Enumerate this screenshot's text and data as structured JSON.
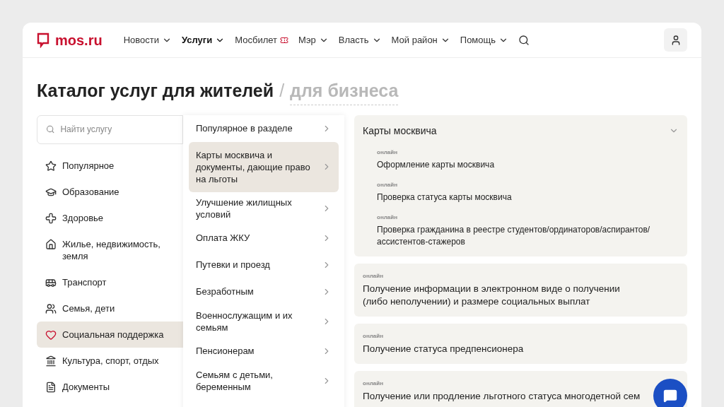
{
  "header": {
    "logo": "mos.ru",
    "nav": [
      {
        "label": "Новости",
        "selected": false,
        "kind": "dropdown"
      },
      {
        "label": "Услуги",
        "selected": true,
        "kind": "dropdown"
      },
      {
        "label": "Мосбилет",
        "selected": false,
        "kind": "ticket"
      },
      {
        "label": "Мэр",
        "selected": false,
        "kind": "dropdown"
      },
      {
        "label": "Власть",
        "selected": false,
        "kind": "dropdown"
      },
      {
        "label": "Мой район",
        "selected": false,
        "kind": "dropdown"
      },
      {
        "label": "Помощь",
        "selected": false,
        "kind": "dropdown"
      }
    ]
  },
  "title": {
    "main": "Каталог услуг для жителей",
    "separator": "/",
    "alt": "для бизнеса"
  },
  "search": {
    "placeholder": "Найти услугу"
  },
  "categories": [
    {
      "label": "Популярное",
      "selected": false
    },
    {
      "label": "Образование",
      "selected": false
    },
    {
      "label": "Здоровье",
      "selected": false
    },
    {
      "label": "Жилье, недвижимость, земля",
      "selected": false
    },
    {
      "label": "Транспорт",
      "selected": false
    },
    {
      "label": "Семья, дети",
      "selected": false
    },
    {
      "label": "Социальная поддержка",
      "selected": true
    },
    {
      "label": "Культура, спорт, отдых",
      "selected": false
    },
    {
      "label": "Документы",
      "selected": false
    }
  ],
  "subcategories": [
    {
      "label": "Популярное в разделе",
      "selected": false
    },
    {
      "label": "Карты москвича и документы, дающие право на льготы",
      "selected": true
    },
    {
      "label": "Улучшение жилищных условий",
      "selected": false
    },
    {
      "label": "Оплата ЖКУ",
      "selected": false
    },
    {
      "label": "Путевки и проезд",
      "selected": false
    },
    {
      "label": "Безработным",
      "selected": false
    },
    {
      "label": "Военнослужащим и их семьям",
      "selected": false
    },
    {
      "label": "Пенсионерам",
      "selected": false
    },
    {
      "label": "Семьям с детьми, беременным",
      "selected": false
    }
  ],
  "services": [
    {
      "kind": "group",
      "title": "Карты москвича",
      "expanded": true,
      "items": [
        {
          "tag": "онлайн",
          "title": "Оформление карты москвича"
        },
        {
          "tag": "онлайн",
          "title": "Проверка статуса карты москвича"
        },
        {
          "tag": "онлайн",
          "title": "Проверка гражданина в реестре студентов/ординаторов/аспирантов/ ассистентов-стажеров"
        }
      ]
    },
    {
      "kind": "single",
      "tag": "онлайн",
      "title": "Получение информации в электронном виде о получении (либо неполучении) и размере социальных выплат"
    },
    {
      "kind": "single",
      "tag": "онлайн",
      "title": "Получение статуса предпенсионера"
    },
    {
      "kind": "single",
      "tag": "онлайн",
      "title": "Получение или продление льготного статуса многодетной сем"
    }
  ]
}
